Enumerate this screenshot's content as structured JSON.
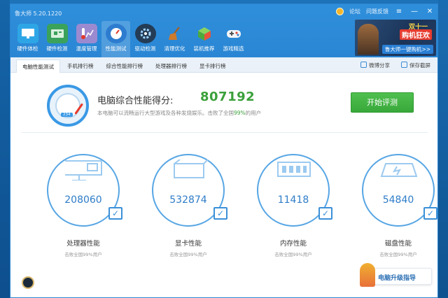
{
  "app": {
    "title": "鲁大师 5.20.1220"
  },
  "topbar": {
    "links": [
      "论坛",
      "问题反馈"
    ],
    "controls": [
      "≡",
      "—",
      "✕"
    ]
  },
  "nav": [
    {
      "label": "硬件体检",
      "icon": "monitor-icon",
      "color": "#2ea6e6"
    },
    {
      "label": "硬件检测",
      "icon": "circuit-board-icon",
      "color": "#3ba25c"
    },
    {
      "label": "温度管理",
      "icon": "thermometer-chart-icon",
      "color": "#9c8ad0"
    },
    {
      "label": "性能测试",
      "icon": "speedometer-icon",
      "color": "#2d7ccf"
    },
    {
      "label": "驱动检测",
      "icon": "gear-icon",
      "color": "#243c55"
    },
    {
      "label": "清理优化",
      "icon": "broom-icon",
      "color": "#d07a2b"
    },
    {
      "label": "装机推荐",
      "icon": "box-icon",
      "color": "#5cbf45"
    },
    {
      "label": "游戏精选",
      "icon": "gamepad-icon",
      "color": "#e0e6ec"
    }
  ],
  "promo": {
    "line1": "双十一",
    "line2": "购机狂欢",
    "button": "鲁大师一键购机>>"
  },
  "subtabs": {
    "tabs": [
      "电脑性能测试",
      "手机排行榜",
      "综合性能排行榜",
      "处理器排行榜",
      "显卡排行榜"
    ],
    "share": "微博分享",
    "screenshot": "保存截屏"
  },
  "score": {
    "label": "电脑综合性能得分:",
    "value": "807192",
    "desc_prefix": "本电脑可以流畅运行大型游戏及各种发烧娱乐。击败了全国",
    "desc_pct": "99%",
    "desc_suffix": "的用户",
    "gauge_number": "234"
  },
  "start_button": "开始评测",
  "cards": [
    {
      "value": "208060",
      "name": "处理器性能",
      "sub": "击败全国99%用户"
    },
    {
      "value": "532874",
      "name": "显卡性能",
      "sub": "击败全国99%用户"
    },
    {
      "value": "11418",
      "name": "内存性能",
      "sub": "击败全国99%用户"
    },
    {
      "value": "54840",
      "name": "磁盘性能",
      "sub": "击败全国99%用户"
    }
  ],
  "guide": {
    "label": "电脑升级指导"
  }
}
